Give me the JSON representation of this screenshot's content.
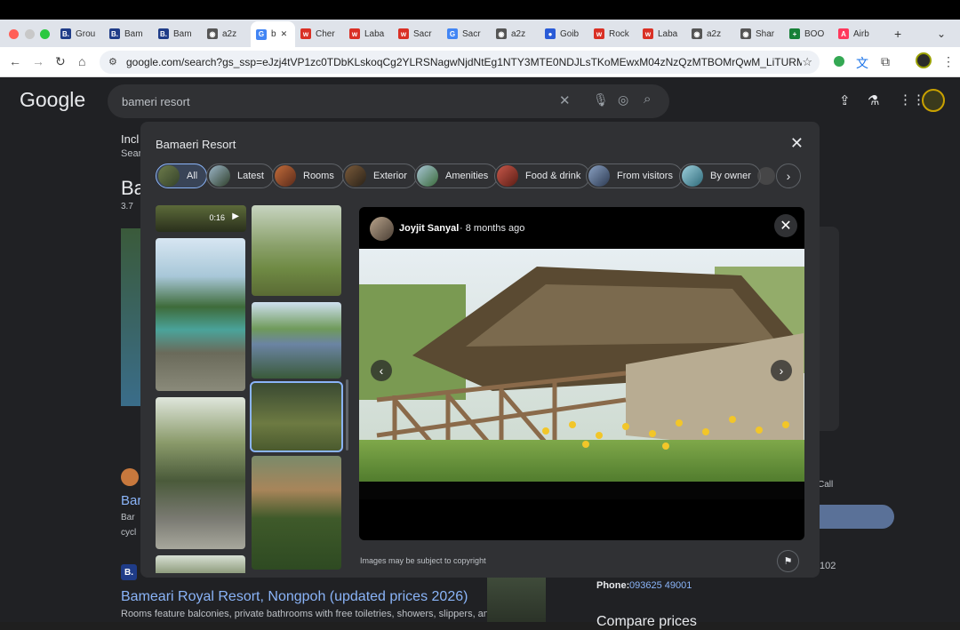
{
  "browser": {
    "tabs": [
      {
        "label": "Grou",
        "icon": "booking-icon",
        "color": "#1f3c88",
        "glyph": "B."
      },
      {
        "label": "Bam",
        "icon": "booking-icon",
        "color": "#1f3c88",
        "glyph": "B."
      },
      {
        "label": "Bam",
        "icon": "booking-icon",
        "color": "#1f3c88",
        "glyph": "B."
      },
      {
        "label": "a2z",
        "icon": "globe-icon",
        "color": "#555555",
        "glyph": "◉"
      },
      {
        "label": "b",
        "icon": "google-icon",
        "color": "#4285f4",
        "glyph": "G"
      },
      {
        "label": "Cher",
        "icon": "site-icon",
        "color": "#d93025",
        "glyph": "ᴡ"
      },
      {
        "label": "Laba",
        "icon": "site-icon",
        "color": "#d93025",
        "glyph": "ᴡ"
      },
      {
        "label": "Sacr",
        "icon": "site-icon",
        "color": "#d93025",
        "glyph": "ᴡ"
      },
      {
        "label": "Sacr",
        "icon": "google-icon",
        "color": "#4285f4",
        "glyph": "G"
      },
      {
        "label": "a2z",
        "icon": "globe-icon",
        "color": "#555555",
        "glyph": "◉"
      },
      {
        "label": "Goib",
        "icon": "goibibo-icon",
        "color": "#2a5bd7",
        "glyph": "●"
      },
      {
        "label": "Rock",
        "icon": "site-icon",
        "color": "#d93025",
        "glyph": "ᴡ"
      },
      {
        "label": "Laba",
        "icon": "site-icon",
        "color": "#d93025",
        "glyph": "ᴡ"
      },
      {
        "label": "a2z",
        "icon": "globe-icon",
        "color": "#555555",
        "glyph": "◉"
      },
      {
        "label": "Shar",
        "icon": "globe-icon",
        "color": "#555555",
        "glyph": "◉"
      },
      {
        "label": "BOO",
        "icon": "sheets-icon",
        "color": "#188038",
        "glyph": "+"
      },
      {
        "label": "Airb",
        "icon": "airbnb-icon",
        "color": "#ff385c",
        "glyph": "A"
      }
    ],
    "new_tab_glyph": "+",
    "url": "google.com/search?gs_ssp=eJzj4tVP1zc0TDbKLskoqCg2YLRSNagwNjdNtEg1NTY3MTE0NDJLsTKoMEwxM04zNzQzMTBOMrQwM_LiTURMTS3KVChKLc..."
  },
  "google": {
    "logo": "Google",
    "query": "bameri resort",
    "bg_snippets": {
      "incl": "Incl",
      "sear": "Sear",
      "ba": "Ba",
      "rating": "3.7",
      "bar1": "Bar",
      "bar2": "Bar",
      "cycl": "cycl",
      "result_title": "Bameari Royal Resort, Nongpoh (updated prices 2026)",
      "result_desc": "Rooms feature balconies, private bathrooms with free toiletries, showers, slippers, and",
      "call": "Call",
      "phone_label": "Phone:",
      "phone": "093625 49001",
      "phone2": "102",
      "compare": "Compare prices"
    }
  },
  "overlay": {
    "title": "Bamaeri Resort",
    "chips": [
      {
        "label": "All",
        "active": true
      },
      {
        "label": "Latest"
      },
      {
        "label": "Rooms"
      },
      {
        "label": "Exterior"
      },
      {
        "label": "Amenities"
      },
      {
        "label": "Food & drink"
      },
      {
        "label": "From visitors"
      },
      {
        "label": "By owner"
      }
    ],
    "video_duration": "0:16",
    "viewer": {
      "author": "Joyjit Sanyal",
      "time": "8 months ago"
    },
    "copyright": "Images may be subject to copyright"
  }
}
